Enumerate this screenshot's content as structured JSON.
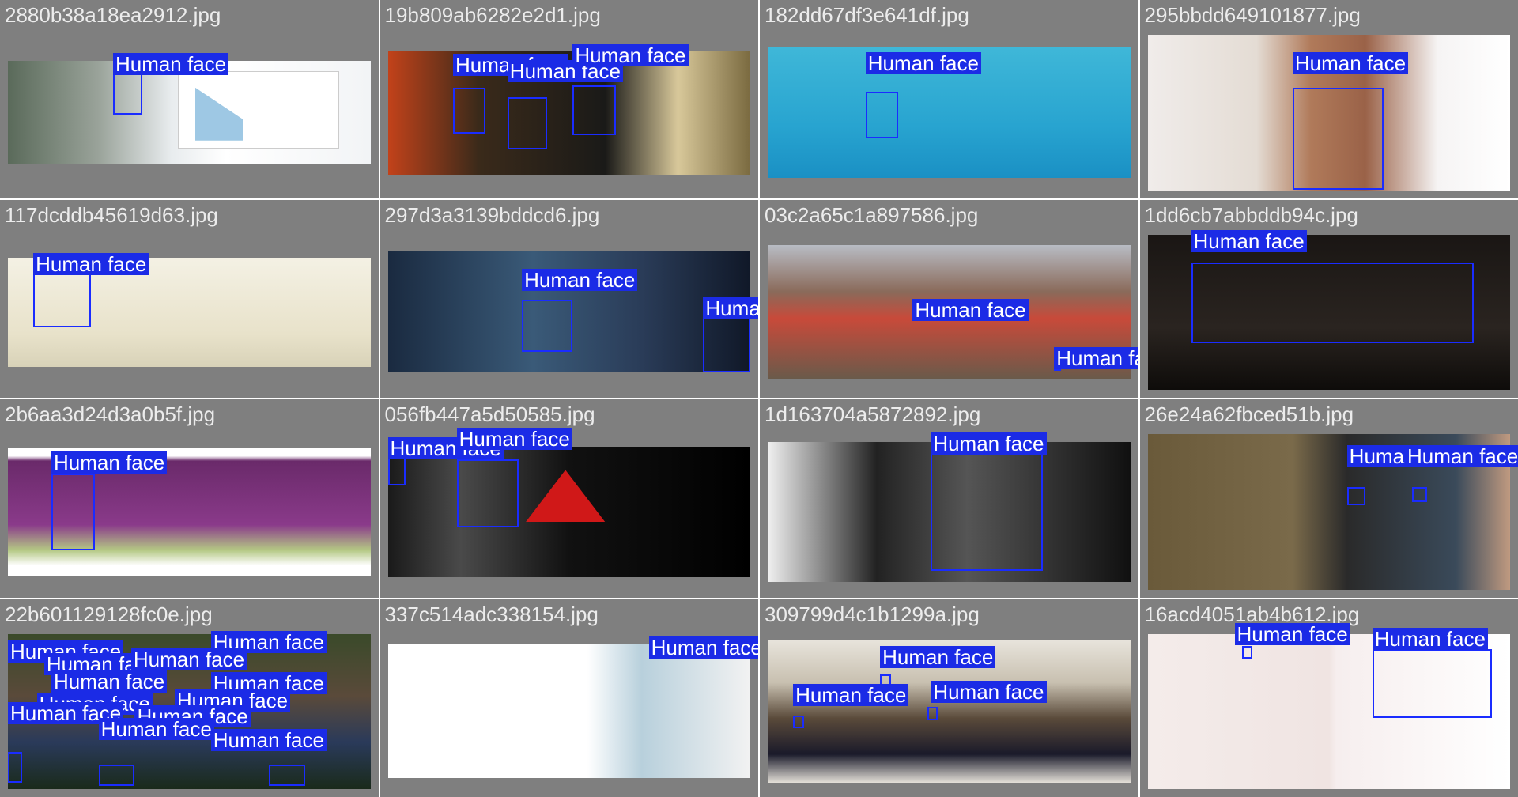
{
  "label": "Human face",
  "tiles": [
    {
      "file": "2880b38a18ea2912.jpg",
      "bg": "linear-gradient(90deg,#5a6a5a 0%,#9aa39a 25%,#e8ecee 45%,#ffffff 60%,#f2f4f6 100%)"
    },
    {
      "file": "19b809ab6282e2d1.jpg",
      "bg": "linear-gradient(90deg,#c2421a 0%,#3a2a1a 25%,#1a1a18 60%,#d8c89a 80%,#7a6a40 100%)"
    },
    {
      "file": "182dd67df3e641df.jpg",
      "bg": "linear-gradient(180deg,#3fb7d8 0%,#28a4d0 60%,#1a90c4 100%)"
    },
    {
      "file": "295bbdd649101877.jpg",
      "bg": "linear-gradient(90deg,#f0ecea 0%,#e4dcd4 30%,#b07a5a 45%,#9a6248 60%,#f6f4f4 80%,#ffffff 100%)"
    },
    {
      "file": "117dcddb45619d63.jpg",
      "bg": "linear-gradient(180deg,#f4f1e4 0%,#e8e2ca 70%,#d8d2b8 100%)"
    },
    {
      "file": "297d3a3139bddcd6.jpg",
      "bg": "linear-gradient(90deg,#1a2a40 0%,#3a5a78 40%,#2a3c58 70%,#101828 100%)"
    },
    {
      "file": "03c2a65c1a897586.jpg",
      "bg": "linear-gradient(180deg,#b8bcc4 0%,#8a6a5a 35%,#c84a3a 55%,#6a5a4a 100%)"
    },
    {
      "file": "1dd6cb7abbddb94c.jpg",
      "bg": "linear-gradient(180deg,#1a1614 0%,#2a2420 60%,#0e0c0a 100%)"
    },
    {
      "file": "2b6aa3d24d3a0b5f.jpg",
      "bg": "linear-gradient(180deg,#ffffff 0%,#ffffff 6%,#6a2a6a 10%,#8a3a8a 60%,#b4c884 80%,#ffffff 92%)"
    },
    {
      "file": "056fb447a5d50585.jpg",
      "bg": "linear-gradient(90deg,#1a1a1a 0%,#4a4a4a 20%,#111111 50%,#000000 100%)"
    },
    {
      "file": "1d163704a5872892.jpg",
      "bg": "linear-gradient(90deg,#f0f0f0 0%,#222222 30%,#555555 55%,#101010 100%)"
    },
    {
      "file": "26e24a62fbced51b.jpg",
      "bg": "linear-gradient(90deg,#6a5a3a 0%,#7a6a4a 40%,#2a2a2a 55%,#3a4a5a 85%,#c09a80 100%)"
    },
    {
      "file": "22b601129128fc0e.jpg",
      "bg": "linear-gradient(180deg,#3a4a2a 0%,#5a4a3a 40%,#2a3a5a 70%,#1a2a1a 100%)"
    },
    {
      "file": "337c514adc338154.jpg",
      "bg": "linear-gradient(90deg,#ffffff 0%,#ffffff 55%,#b8d0dc 70%,#f2f2f2 100%)"
    },
    {
      "file": "309799d4c1b1299a.jpg",
      "bg": "linear-gradient(180deg,#e8e4dc 0%,#c8c0b0 30%,#5a4a3a 55%,#1a1a2a 80%,#e4e0d8 100%)"
    },
    {
      "file": "16acd4051ab4b612.jpg",
      "bg": "linear-gradient(90deg,#f4ecea 0%,#f0e4e2 50%,#f6eeee 52%,#ffffff 100%)"
    }
  ]
}
